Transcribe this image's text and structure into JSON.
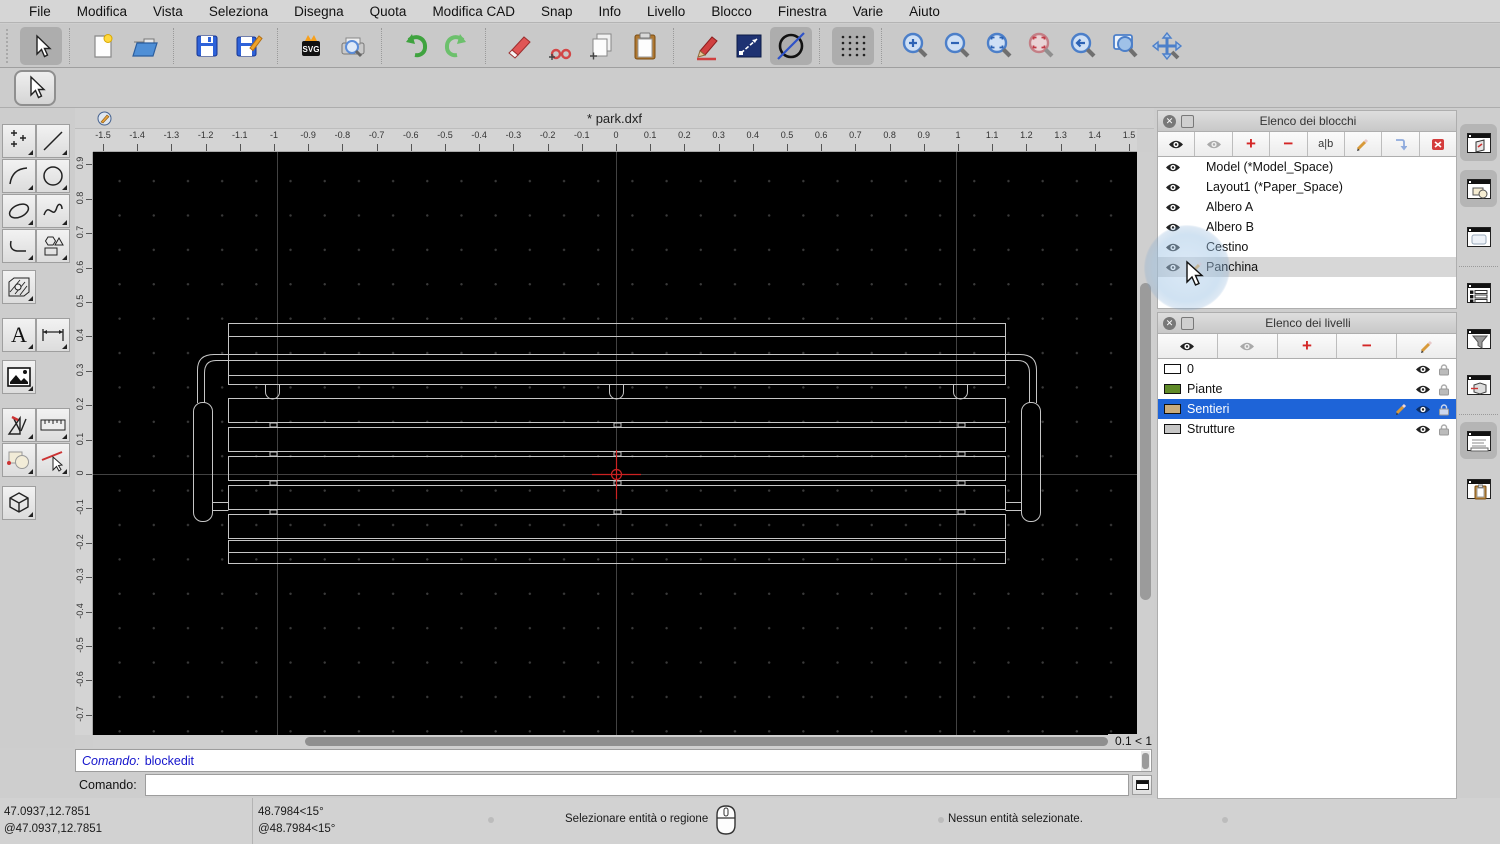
{
  "menubar": {
    "items": [
      "File",
      "Modifica",
      "Vista",
      "Seleziona",
      "Disegna",
      "Quota",
      "Modifica CAD",
      "Snap",
      "Info",
      "Livello",
      "Blocco",
      "Finestra",
      "Varie",
      "Aiuto"
    ]
  },
  "toolbar": {
    "icons": [
      "pointer-tool",
      "new-file",
      "open-file",
      "save-file",
      "save-as",
      "svg-export",
      "print-preview",
      "undo",
      "redo",
      "eraser",
      "cut",
      "copy",
      "paste",
      "draw-pen",
      "line-settings",
      "no-fill",
      "grid-toggle",
      "zoom-in",
      "zoom-out",
      "zoom-fit",
      "zoom-selection",
      "zoom-previous",
      "zoom-window",
      "pan"
    ]
  },
  "palette": {
    "icons": [
      "point-tool",
      "line-tool",
      "arc-tool",
      "circle-tool",
      "ellipse-tool",
      "spline-tool",
      "polyline-tool",
      "shape-tool",
      "hatch-tool",
      "text-tool",
      "dimension-tool",
      "image-tool",
      "modify-tool",
      "measure-tool",
      "info-tool",
      "snap-tool",
      "solid-tool"
    ]
  },
  "document": {
    "title": "* park.dxf",
    "zoom_indicator": "0.1 < 1"
  },
  "rulers": {
    "horizontal": [
      "-1.5",
      "-1.4",
      "-1.3",
      "-1.2",
      "-1.1",
      "-1",
      "-0.9",
      "-0.8",
      "-0.7",
      "-0.6",
      "-0.5",
      "-0.4",
      "-0.3",
      "-0.2",
      "-0.1",
      "0",
      "0.1",
      "0.2",
      "0.3",
      "0.4",
      "0.5",
      "0.6",
      "0.7",
      "0.8",
      "0.9",
      "1",
      "1.1",
      "1.2",
      "1.3",
      "1.4",
      "1.5"
    ],
    "vertical": [
      "0.9",
      "0.8",
      "0.7",
      "0.6",
      "0.5",
      "0.4",
      "0.3",
      "0.2",
      "0.1",
      "0",
      "-0.1",
      "-0.2",
      "-0.3",
      "-0.4",
      "-0.5",
      "-0.6",
      "-0.7"
    ]
  },
  "blocks_panel": {
    "title": "Elenco dei blocchi",
    "toolbar_icons": [
      "show-all-blocks-eye",
      "hide-all-blocks-eye",
      "add-block",
      "remove-block",
      "rename-block",
      "edit-block",
      "insert-block",
      "purge-block"
    ],
    "rename_label": "a|b",
    "items": [
      {
        "name": "Model (*Model_Space)",
        "selected": false,
        "editing": false
      },
      {
        "name": "Layout1 (*Paper_Space)",
        "selected": false,
        "editing": false
      },
      {
        "name": "Albero A",
        "selected": false,
        "editing": false
      },
      {
        "name": "Albero B",
        "selected": false,
        "editing": false
      },
      {
        "name": "Cestino",
        "selected": false,
        "editing": false
      },
      {
        "name": "Panchina",
        "selected": true,
        "editing": true
      }
    ]
  },
  "layers_panel": {
    "title": "Elenco dei livelli",
    "toolbar_icons": [
      "show-all-layers-eye",
      "hide-all-layers-eye",
      "add-layer",
      "remove-layer",
      "edit-layer"
    ],
    "items": [
      {
        "name": "0",
        "color": "#ffffff",
        "selected": false,
        "current": false
      },
      {
        "name": "Piante",
        "color": "#5f8a28",
        "selected": false,
        "current": false
      },
      {
        "name": "Sentieri",
        "color": "#c9ac7c",
        "selected": true,
        "current": true
      },
      {
        "name": "Strutture",
        "color": "#c6c6c6",
        "selected": false,
        "current": false
      }
    ]
  },
  "dock_strip": {
    "icons": [
      "block-list-panel",
      "block-edit-panel",
      "property-editor-panel",
      "layer-list-panel",
      "filter-panel",
      "library-browser-panel",
      "command-line-panel",
      "clipboard-panel"
    ]
  },
  "command": {
    "history_label": "Comando:",
    "history_value": "blockedit",
    "prompt_label": "Comando:",
    "input_value": "",
    "input_placeholder": ""
  },
  "statusbar": {
    "abs_coord": "47.0937,12.7851",
    "rel_coord": "@47.0937,12.7851",
    "abs_polar": "48.7984<15°",
    "rel_polar": "@48.7984<15°",
    "hint": "Selezionare entità o regione",
    "selection_status": "Nessun entità selezionate."
  },
  "colors": {
    "selection_blue": "#1e64d8",
    "canvas_bg": "#000000",
    "entity_stroke": "#c6c6c6",
    "crosshair_red": "#cc2222"
  }
}
